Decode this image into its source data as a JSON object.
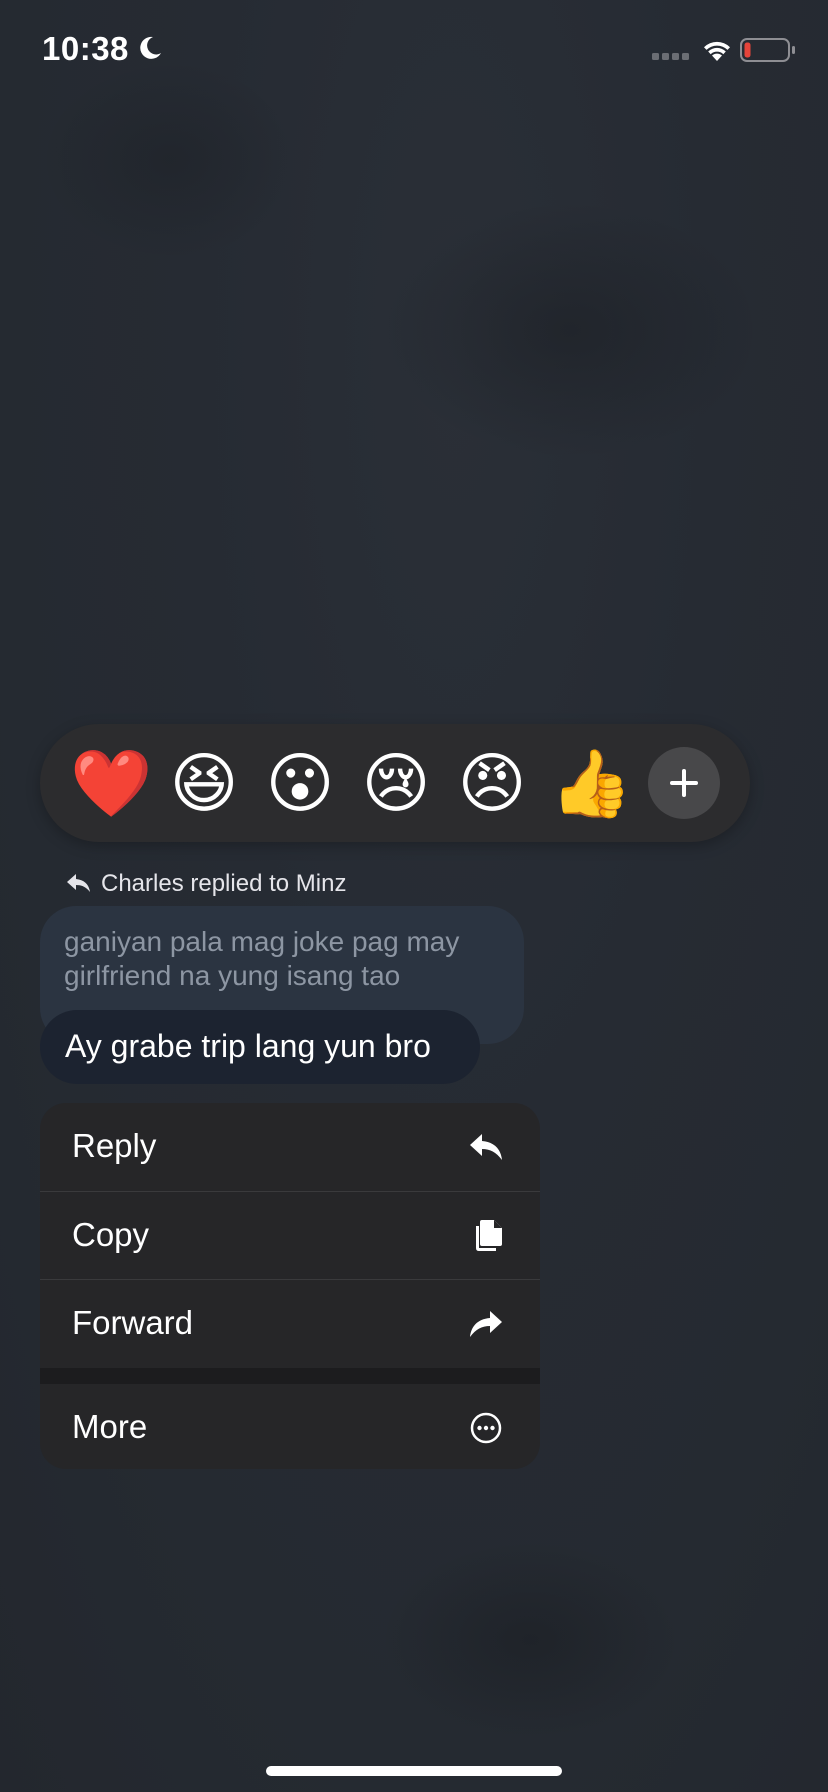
{
  "status_bar": {
    "time": "10:38"
  },
  "reactions": [
    {
      "emoji": "❤️",
      "name": "heart"
    },
    {
      "emoji": "😆",
      "name": "laughing"
    },
    {
      "emoji": "😮",
      "name": "surprised"
    },
    {
      "emoji": "😢",
      "name": "crying"
    },
    {
      "emoji": "😠",
      "name": "angry"
    },
    {
      "emoji": "👍",
      "name": "thumbs-up"
    }
  ],
  "reply_context": {
    "text": "Charles replied to Minz"
  },
  "quoted_message": {
    "line1": "ganiyan pala mag joke pag may",
    "line2": "girlfriend na yung isang tao"
  },
  "message": {
    "text": "Ay grabe trip lang yun bro"
  },
  "menu": {
    "reply": "Reply",
    "copy": "Copy",
    "forward": "Forward",
    "more": "More"
  },
  "colors": {
    "background": "#262b33",
    "menu_bg": "#262628",
    "quoted_bubble": "#2b3441",
    "message_bubble": "#1c2330",
    "battery_low": "#e5443a"
  }
}
